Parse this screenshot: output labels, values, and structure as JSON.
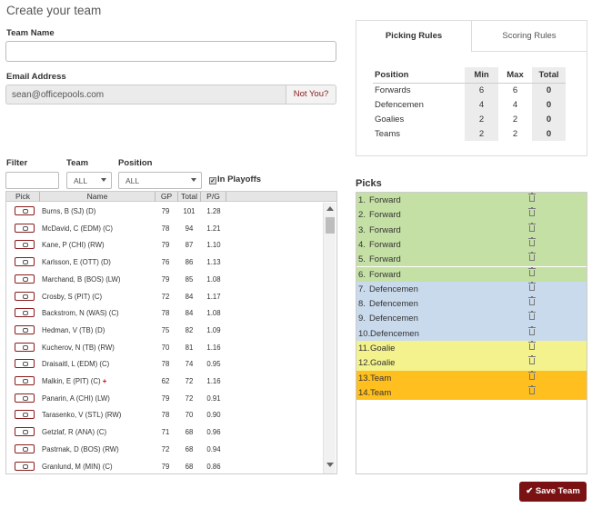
{
  "page_title": "Create your team",
  "team_name": {
    "label": "Team Name",
    "value": ""
  },
  "email": {
    "label": "Email Address",
    "value": "sean@officepools.com",
    "not_you": "Not You?"
  },
  "rules": {
    "tabs": [
      "Picking Rules",
      "Scoring Rules"
    ],
    "active_tab": "Picking Rules",
    "headers": [
      "Position",
      "Min",
      "Max",
      "Total"
    ],
    "rows": [
      [
        "Forwards",
        "6",
        "6",
        "0"
      ],
      [
        "Defencemen",
        "4",
        "4",
        "0"
      ],
      [
        "Goalies",
        "2",
        "2",
        "0"
      ],
      [
        "Teams",
        "2",
        "2",
        "0"
      ]
    ]
  },
  "filters": {
    "filter_label": "Filter",
    "filter_value": "",
    "team_label": "Team",
    "team_value": "ALL",
    "position_label": "Position",
    "position_value": "ALL",
    "playoffs_label": "In Playoffs",
    "playoffs_checked": true
  },
  "players_table": {
    "headers": [
      "Pick",
      "Name",
      "GP",
      "Total",
      "P/G"
    ],
    "rows": [
      {
        "name": "Burns, B (SJ) (D)",
        "gp": "79",
        "total": "101",
        "ppg": "1.28"
      },
      {
        "name": "McDavid, C (EDM) (C)",
        "gp": "78",
        "total": "94",
        "ppg": "1.21"
      },
      {
        "name": "Kane, P (CHI) (RW)",
        "gp": "79",
        "total": "87",
        "ppg": "1.10"
      },
      {
        "name": "Karlsson, E (OTT) (D)",
        "gp": "76",
        "total": "86",
        "ppg": "1.13"
      },
      {
        "name": "Marchand, B (BOS) (LW)",
        "gp": "79",
        "total": "85",
        "ppg": "1.08"
      },
      {
        "name": "Crosby, S (PIT) (C)",
        "gp": "72",
        "total": "84",
        "ppg": "1.17"
      },
      {
        "name": "Backstrom, N (WAS) (C)",
        "gp": "78",
        "total": "84",
        "ppg": "1.08"
      },
      {
        "name": "Hedman, V (TB) (D)",
        "gp": "75",
        "total": "82",
        "ppg": "1.09"
      },
      {
        "name": "Kucherov, N (TB) (RW)",
        "gp": "70",
        "total": "81",
        "ppg": "1.16"
      },
      {
        "name": "Draisaitl, L (EDM) (C)",
        "gp": "78",
        "total": "74",
        "ppg": "0.95"
      },
      {
        "name": "Malkin, E (PIT) (C)",
        "gp": "62",
        "total": "72",
        "ppg": "1.16",
        "injured": "+"
      },
      {
        "name": "Panarin, A (CHI) (LW)",
        "gp": "79",
        "total": "72",
        "ppg": "0.91"
      },
      {
        "name": "Tarasenko, V (STL) (RW)",
        "gp": "78",
        "total": "70",
        "ppg": "0.90"
      },
      {
        "name": "Getzlaf, R (ANA) (C)",
        "gp": "71",
        "total": "68",
        "ppg": "0.96"
      },
      {
        "name": "Pastrnak, D (BOS) (RW)",
        "gp": "72",
        "total": "68",
        "ppg": "0.94"
      },
      {
        "name": "Granlund, M (MIN) (C)",
        "gp": "79",
        "total": "68",
        "ppg": "0.86"
      }
    ]
  },
  "picks": {
    "title": "Picks",
    "colors": {
      "Forward": "#c5e0a5",
      "Defencemen": "#c9daec",
      "Goalie": "#f4f28c",
      "Team": "#ffbf1f"
    },
    "rows": [
      {
        "num": "1.",
        "label": "Forward",
        "group": "Forward"
      },
      {
        "num": "2.",
        "label": "Forward",
        "group": "Forward"
      },
      {
        "num": "3.",
        "label": "Forward",
        "group": "Forward"
      },
      {
        "num": "4.",
        "label": "Forward",
        "group": "Forward"
      },
      {
        "num": "5.",
        "label": "Forward",
        "group": "Forward"
      },
      {
        "num": "6.",
        "label": "Forward",
        "group": "Forward"
      },
      {
        "num": "7.",
        "label": "Defencemen",
        "group": "Defencemen"
      },
      {
        "num": "8.",
        "label": "Defencemen",
        "group": "Defencemen"
      },
      {
        "num": "9.",
        "label": "Defencemen",
        "group": "Defencemen"
      },
      {
        "num": "10.",
        "label": "Defencemen",
        "group": "Defencemen"
      },
      {
        "num": "11.",
        "label": "Goalie",
        "group": "Goalie"
      },
      {
        "num": "12.",
        "label": "Goalie",
        "group": "Goalie"
      },
      {
        "num": "13.",
        "label": "Team",
        "group": "Team"
      },
      {
        "num": "14.",
        "label": "Team",
        "group": "Team"
      }
    ]
  },
  "save_button": "Save Team"
}
